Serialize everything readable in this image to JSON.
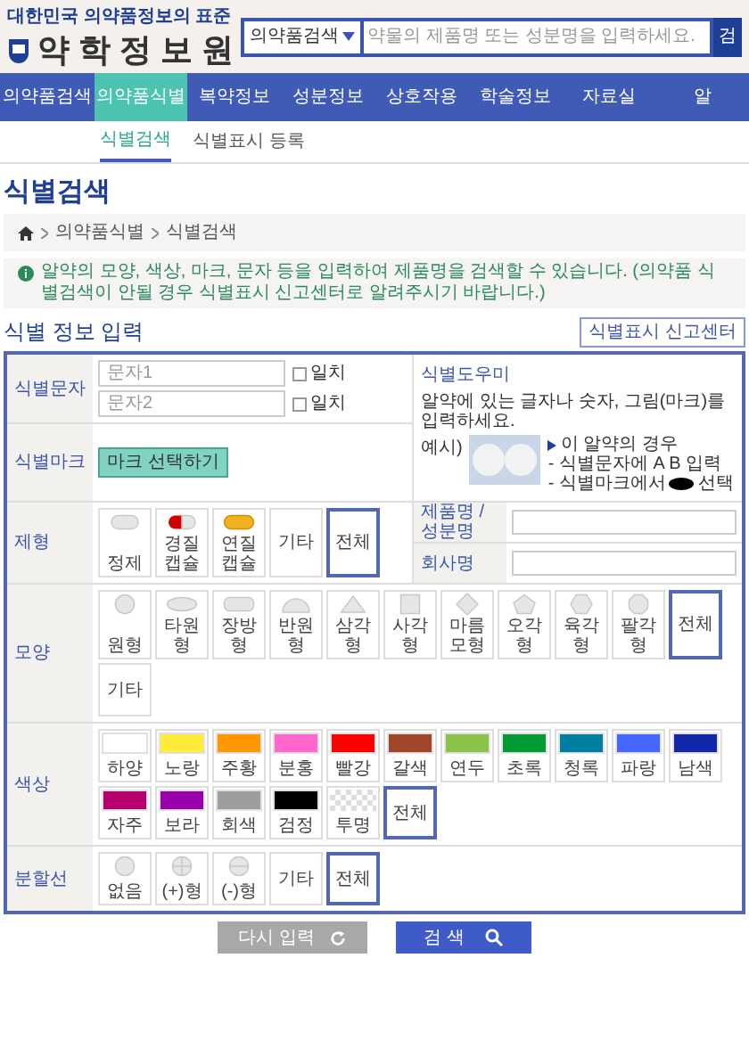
{
  "header": {
    "tagline": "대한민국 의약품정보의 표준",
    "logo_text": "약 학 정 보 원",
    "search": {
      "category": "의약품검색",
      "placeholder": "약물의 제품명 또는 성분명을 입력하세요.",
      "button": "검"
    }
  },
  "nav": [
    {
      "label": "의약품검색",
      "selected": false
    },
    {
      "label": "의약품식별",
      "selected": true
    },
    {
      "label": "복약정보",
      "selected": false
    },
    {
      "label": "성분정보",
      "selected": false
    },
    {
      "label": "상호작용",
      "selected": false
    },
    {
      "label": "학술정보",
      "selected": false
    },
    {
      "label": "자료실",
      "selected": false
    },
    {
      "label": "알",
      "selected": false
    }
  ],
  "subnav": [
    {
      "label": "식별검색",
      "selected": true
    },
    {
      "label": "식별표시 등록",
      "selected": false
    }
  ],
  "page_title": "식별검색",
  "breadcrumb": [
    "의약품식별",
    "식별검색"
  ],
  "notice": "알약의 모양, 색상, 마크, 문자 등을 입력하여 제품명을 검색할 수 있습니다. (의약품 식별검색이 안될 경우 식별표시 신고센터로 알려주시기 바랍니다.)",
  "section_title": "식별 정보 입력",
  "report_button": "식별표시 신고센터",
  "form": {
    "imprint": {
      "label": "식별문자",
      "inputs": [
        {
          "placeholder": "문자1",
          "match_label": "일치",
          "checked": false
        },
        {
          "placeholder": "문자2",
          "match_label": "일치",
          "checked": false
        }
      ]
    },
    "mark": {
      "label": "식별마크",
      "button": "마크 선택하기"
    },
    "helper": {
      "title": "식별도우미",
      "text": "알약에 있는 글자나 숫자, 그림(마크)를 입력하세요.",
      "example_label": "예시)",
      "bullets": [
        "이 알약의 경우",
        "- 식별문자에 A B 입력",
        "- 식별마크에서",
        "선택"
      ]
    },
    "dosage": {
      "label": "제형",
      "options": [
        {
          "label": "정제",
          "kind": "tablet",
          "selected": false
        },
        {
          "label": "경질캡슐",
          "kind": "hard-capsule",
          "selected": false
        },
        {
          "label": "연질캡슐",
          "kind": "soft-capsule",
          "selected": false
        },
        {
          "label": "기타",
          "kind": "text",
          "selected": false
        },
        {
          "label": "전체",
          "kind": "text",
          "selected": true
        }
      ]
    },
    "product_field": {
      "label": "제품명 / 성분명"
    },
    "company_field": {
      "label": "회사명"
    },
    "shape": {
      "label": "모양",
      "options": [
        {
          "label": "원형",
          "kind": "circle",
          "selected": false
        },
        {
          "label": "타원형",
          "kind": "ellipse",
          "selected": false
        },
        {
          "label": "장방형",
          "kind": "oblong",
          "selected": false
        },
        {
          "label": "반원형",
          "kind": "semicircle",
          "selected": false
        },
        {
          "label": "삼각형",
          "kind": "triangle",
          "selected": false
        },
        {
          "label": "사각형",
          "kind": "square",
          "selected": false
        },
        {
          "label": "마름모형",
          "kind": "diamond",
          "selected": false
        },
        {
          "label": "오각형",
          "kind": "pentagon",
          "selected": false
        },
        {
          "label": "육각형",
          "kind": "hexagon",
          "selected": false
        },
        {
          "label": "팔각형",
          "kind": "octagon",
          "selected": false
        },
        {
          "label": "전체",
          "kind": "text",
          "selected": true
        },
        {
          "label": "기타",
          "kind": "text",
          "selected": false
        }
      ]
    },
    "color": {
      "label": "색상",
      "options": [
        {
          "label": "하양",
          "kind": "swatch",
          "color": "#ffffff",
          "selected": false
        },
        {
          "label": "노랑",
          "kind": "swatch",
          "color": "#ffeb3b",
          "selected": false
        },
        {
          "label": "주황",
          "kind": "swatch",
          "color": "#ff9800",
          "selected": false
        },
        {
          "label": "분홍",
          "kind": "swatch",
          "color": "#ff66cc",
          "selected": false
        },
        {
          "label": "빨강",
          "kind": "swatch",
          "color": "#ff0000",
          "selected": false
        },
        {
          "label": "갈색",
          "kind": "swatch",
          "color": "#a0462a",
          "selected": false
        },
        {
          "label": "연두",
          "kind": "swatch",
          "color": "#8bc34a",
          "selected": false
        },
        {
          "label": "초록",
          "kind": "swatch",
          "color": "#009933",
          "selected": false
        },
        {
          "label": "청록",
          "kind": "swatch",
          "color": "#00809f",
          "selected": false
        },
        {
          "label": "파랑",
          "kind": "swatch",
          "color": "#4466ff",
          "selected": false
        },
        {
          "label": "남색",
          "kind": "swatch",
          "color": "#1127a8",
          "selected": false
        },
        {
          "label": "자주",
          "kind": "swatch",
          "color": "#b5006e",
          "selected": false
        },
        {
          "label": "보라",
          "kind": "swatch",
          "color": "#9900aa",
          "selected": false
        },
        {
          "label": "회색",
          "kind": "swatch",
          "color": "#9e9e9e",
          "selected": false
        },
        {
          "label": "검정",
          "kind": "swatch",
          "color": "#000000",
          "selected": false
        },
        {
          "label": "투명",
          "kind": "clear",
          "selected": false
        },
        {
          "label": "전체",
          "kind": "text",
          "selected": true
        }
      ]
    },
    "score": {
      "label": "분할선",
      "options": [
        {
          "label": "없음",
          "kind": "none",
          "selected": false
        },
        {
          "label": "(+)형",
          "kind": "plus",
          "selected": false
        },
        {
          "label": "(-)형",
          "kind": "minus",
          "selected": false
        },
        {
          "label": "기타",
          "kind": "text",
          "selected": false
        },
        {
          "label": "전체",
          "kind": "text",
          "selected": true
        }
      ]
    }
  },
  "buttons": {
    "reset": "다시 입력",
    "search": "검 색"
  }
}
